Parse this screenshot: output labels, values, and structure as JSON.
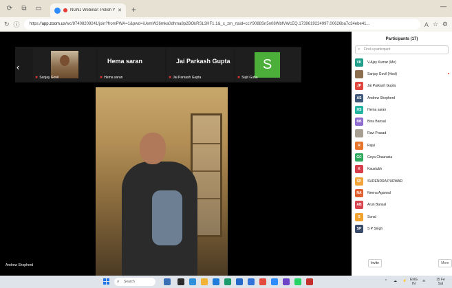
{
  "browser": {
    "tab_title": "NGNJ Webinar: Polish Your",
    "url_prefix": "https://",
    "url_host": "app.zoom.us",
    "url_rest": "/wc/87408209241/join?fromPWA=1&pwd=iUemW26mka0dhma8p2BOkRSL3HF1.1&_x_zm_rtaid=ccY9088Sn5n08WbfVWcEQ.1739619224997.00626ba7c34ebe41..."
  },
  "meeting": {
    "strip": [
      {
        "name_big": "",
        "label": "Sanjay Govil"
      },
      {
        "name_big": "Hema saran",
        "label": "Hema saran"
      },
      {
        "name_big": "Jai Parkash Gupta",
        "label": "Jai Parkash Gupta"
      },
      {
        "name_big": "",
        "label": "Sujit Guha"
      }
    ],
    "s_avatar_letter": "S",
    "active_speaker": "Andrew Shepherd"
  },
  "participants": {
    "title": "Participants (17)",
    "search_placeholder": "Find a participant",
    "invite_label": "Invite",
    "more_label": "More",
    "list": [
      {
        "initials": "VK",
        "name": "V.Ajay Kumar (Me)",
        "color": "#1f9e8a"
      },
      {
        "initials": "",
        "name": "Sanjay Govil (Host)",
        "color": "#8a6e4d"
      },
      {
        "initials": "JP",
        "name": "Jai Parkash Gupta",
        "color": "#e0483f"
      },
      {
        "initials": "AS",
        "name": "Andrew Shepherd",
        "color": "#3e5a7a"
      },
      {
        "initials": "HS",
        "name": "Hema saran",
        "color": "#23b4a2"
      },
      {
        "initials": "BB",
        "name": "Bina Bansal",
        "color": "#8e6bd1"
      },
      {
        "initials": "",
        "name": "Ravi Prasad",
        "color": "#a89f93"
      },
      {
        "initials": "R",
        "name": "Rajul",
        "color": "#e8752c"
      },
      {
        "initials": "GC",
        "name": "Goya Chaurasia",
        "color": "#2eaa5c"
      },
      {
        "initials": "K",
        "name": "Kaustubh",
        "color": "#d63c49"
      },
      {
        "initials": "SP",
        "name": "SURENDRA PURWAR",
        "color": "#f2a33a"
      },
      {
        "initials": "NA",
        "name": "Neena Agarwal",
        "color": "#e0602f"
      },
      {
        "initials": "AB",
        "name": "Arun Bansal",
        "color": "#d9454f"
      },
      {
        "initials": "S",
        "name": "Sonal",
        "color": "#f1a32d"
      },
      {
        "initials": "SP",
        "name": "S P Singh",
        "color": "#3a4c6b"
      }
    ]
  },
  "taskbar": {
    "search_label": "Search",
    "lang_top": "ENG",
    "lang_bottom": "IN",
    "clock_time": "15 Fe",
    "clock_day": "Sat"
  }
}
